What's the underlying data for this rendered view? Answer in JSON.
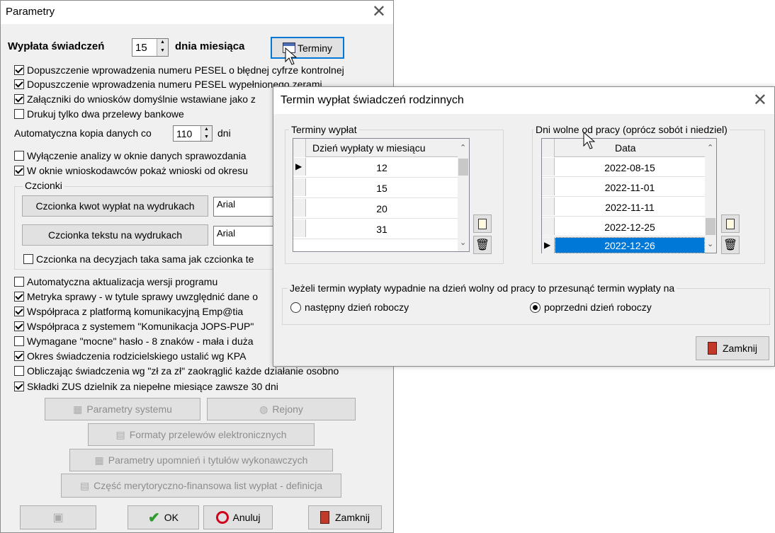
{
  "parametry": {
    "title": "Parametry",
    "wyplata": {
      "prefix": "Wypłata świadczeń",
      "day": "15",
      "suffix": "dnia miesiąca",
      "terminy_button": "Terminy"
    },
    "checkboxes_top": [
      {
        "label": "Dopuszczenie wprowadzenia numeru PESEL o błędnej cyfrze kontrolnej",
        "checked": true
      },
      {
        "label": "Dopuszczenie wprowadzenia numeru PESEL wypełnionego zerami",
        "checked": true
      },
      {
        "label": "Załączniki do wniosków domyślnie wstawiane jako z",
        "checked": true
      },
      {
        "label": "Drukuj tylko dwa przelewy bankowe",
        "checked": false
      }
    ],
    "kopia": {
      "prefix": "Automatyczna kopia danych co",
      "value": "110",
      "suffix": "dni"
    },
    "checkboxes_mid": [
      {
        "label": "Wyłączenie analizy w oknie danych sprawozdania",
        "checked": false
      },
      {
        "label": "W oknie wnioskodawców pokaż wnioski od okresu",
        "checked": true
      }
    ],
    "czcionki": {
      "label": "Czcionki",
      "kwot_button": "Czcionka kwot wypłat na wydrukach",
      "kwot_font": "Arial",
      "tekstu_button": "Czcionka tekstu na wydrukach",
      "tekstu_font": "Arial",
      "decyzje_checkbox": "Czcionka na decyzjach taka sama jak czcionka te"
    },
    "checkboxes_bottom": [
      {
        "label": "Automatyczna aktualizacja wersji programu",
        "checked": false
      },
      {
        "label": "Metryka sprawy - w tytule sprawy uwzględnić dane o",
        "checked": true
      },
      {
        "label": "Współpraca z platformą komunikacyjną Emp@tia",
        "checked": true
      },
      {
        "label": "Współpraca z systemem \"Komunikacja JOPS-PUP\"",
        "checked": true
      },
      {
        "label": "Wymagane \"mocne\" hasło - 8 znaków - mała i duża",
        "checked": false
      },
      {
        "label": "Okres świadczenia rodzicielskiego ustalić wg KPA",
        "checked": true
      },
      {
        "label": "Obliczając świadczenia wg \"zł za zł\"  zaokrąglić każde działanie osobno",
        "checked": false
      },
      {
        "label": "Składki ZUS dzielnik za niepełne miesiące zawsze 30 dni",
        "checked": true
      }
    ],
    "buttons": {
      "parametry_systemu": "Parametry systemu",
      "rejony": "Rejony",
      "formaty": "Formaty przelewów elektronicznych",
      "upomnienia": "Parametry upomnień i tytułów wykonawczych",
      "czesc": "Część merytoryczno-finansowa list wypłat - definicja",
      "ok": "OK",
      "anuluj": "Anuluj",
      "zamknij": "Zamknij"
    }
  },
  "termin": {
    "title": "Termin wypłat świadczeń rodzinnych",
    "terminy_group": "Terminy wypłat",
    "terminy_header": "Dzień wypłaty w miesiącu",
    "terminy_rows": [
      "12",
      "15",
      "20",
      "31"
    ],
    "dni_group": "Dni wolne od pracy (oprócz sobót i niedziel)",
    "dni_header": "Data",
    "dni_rows": [
      "2022-08-15",
      "2022-11-01",
      "2022-11-11",
      "2022-12-25",
      "2022-12-26"
    ],
    "przesun_group": "Jeżeli termin wypłaty wypadnie na dzień wolny od pracy to przesunąć termin wypłaty na",
    "radio_next": "następny dzień roboczy",
    "radio_prev": "poprzedni dzień roboczy",
    "selected_radio": "poprzedni dzień roboczy",
    "zamknij": "Zamknij"
  },
  "colors": {
    "selection": "#0078d7",
    "focus_border": "#0078d7",
    "close_icon_red": "#c0392b"
  }
}
